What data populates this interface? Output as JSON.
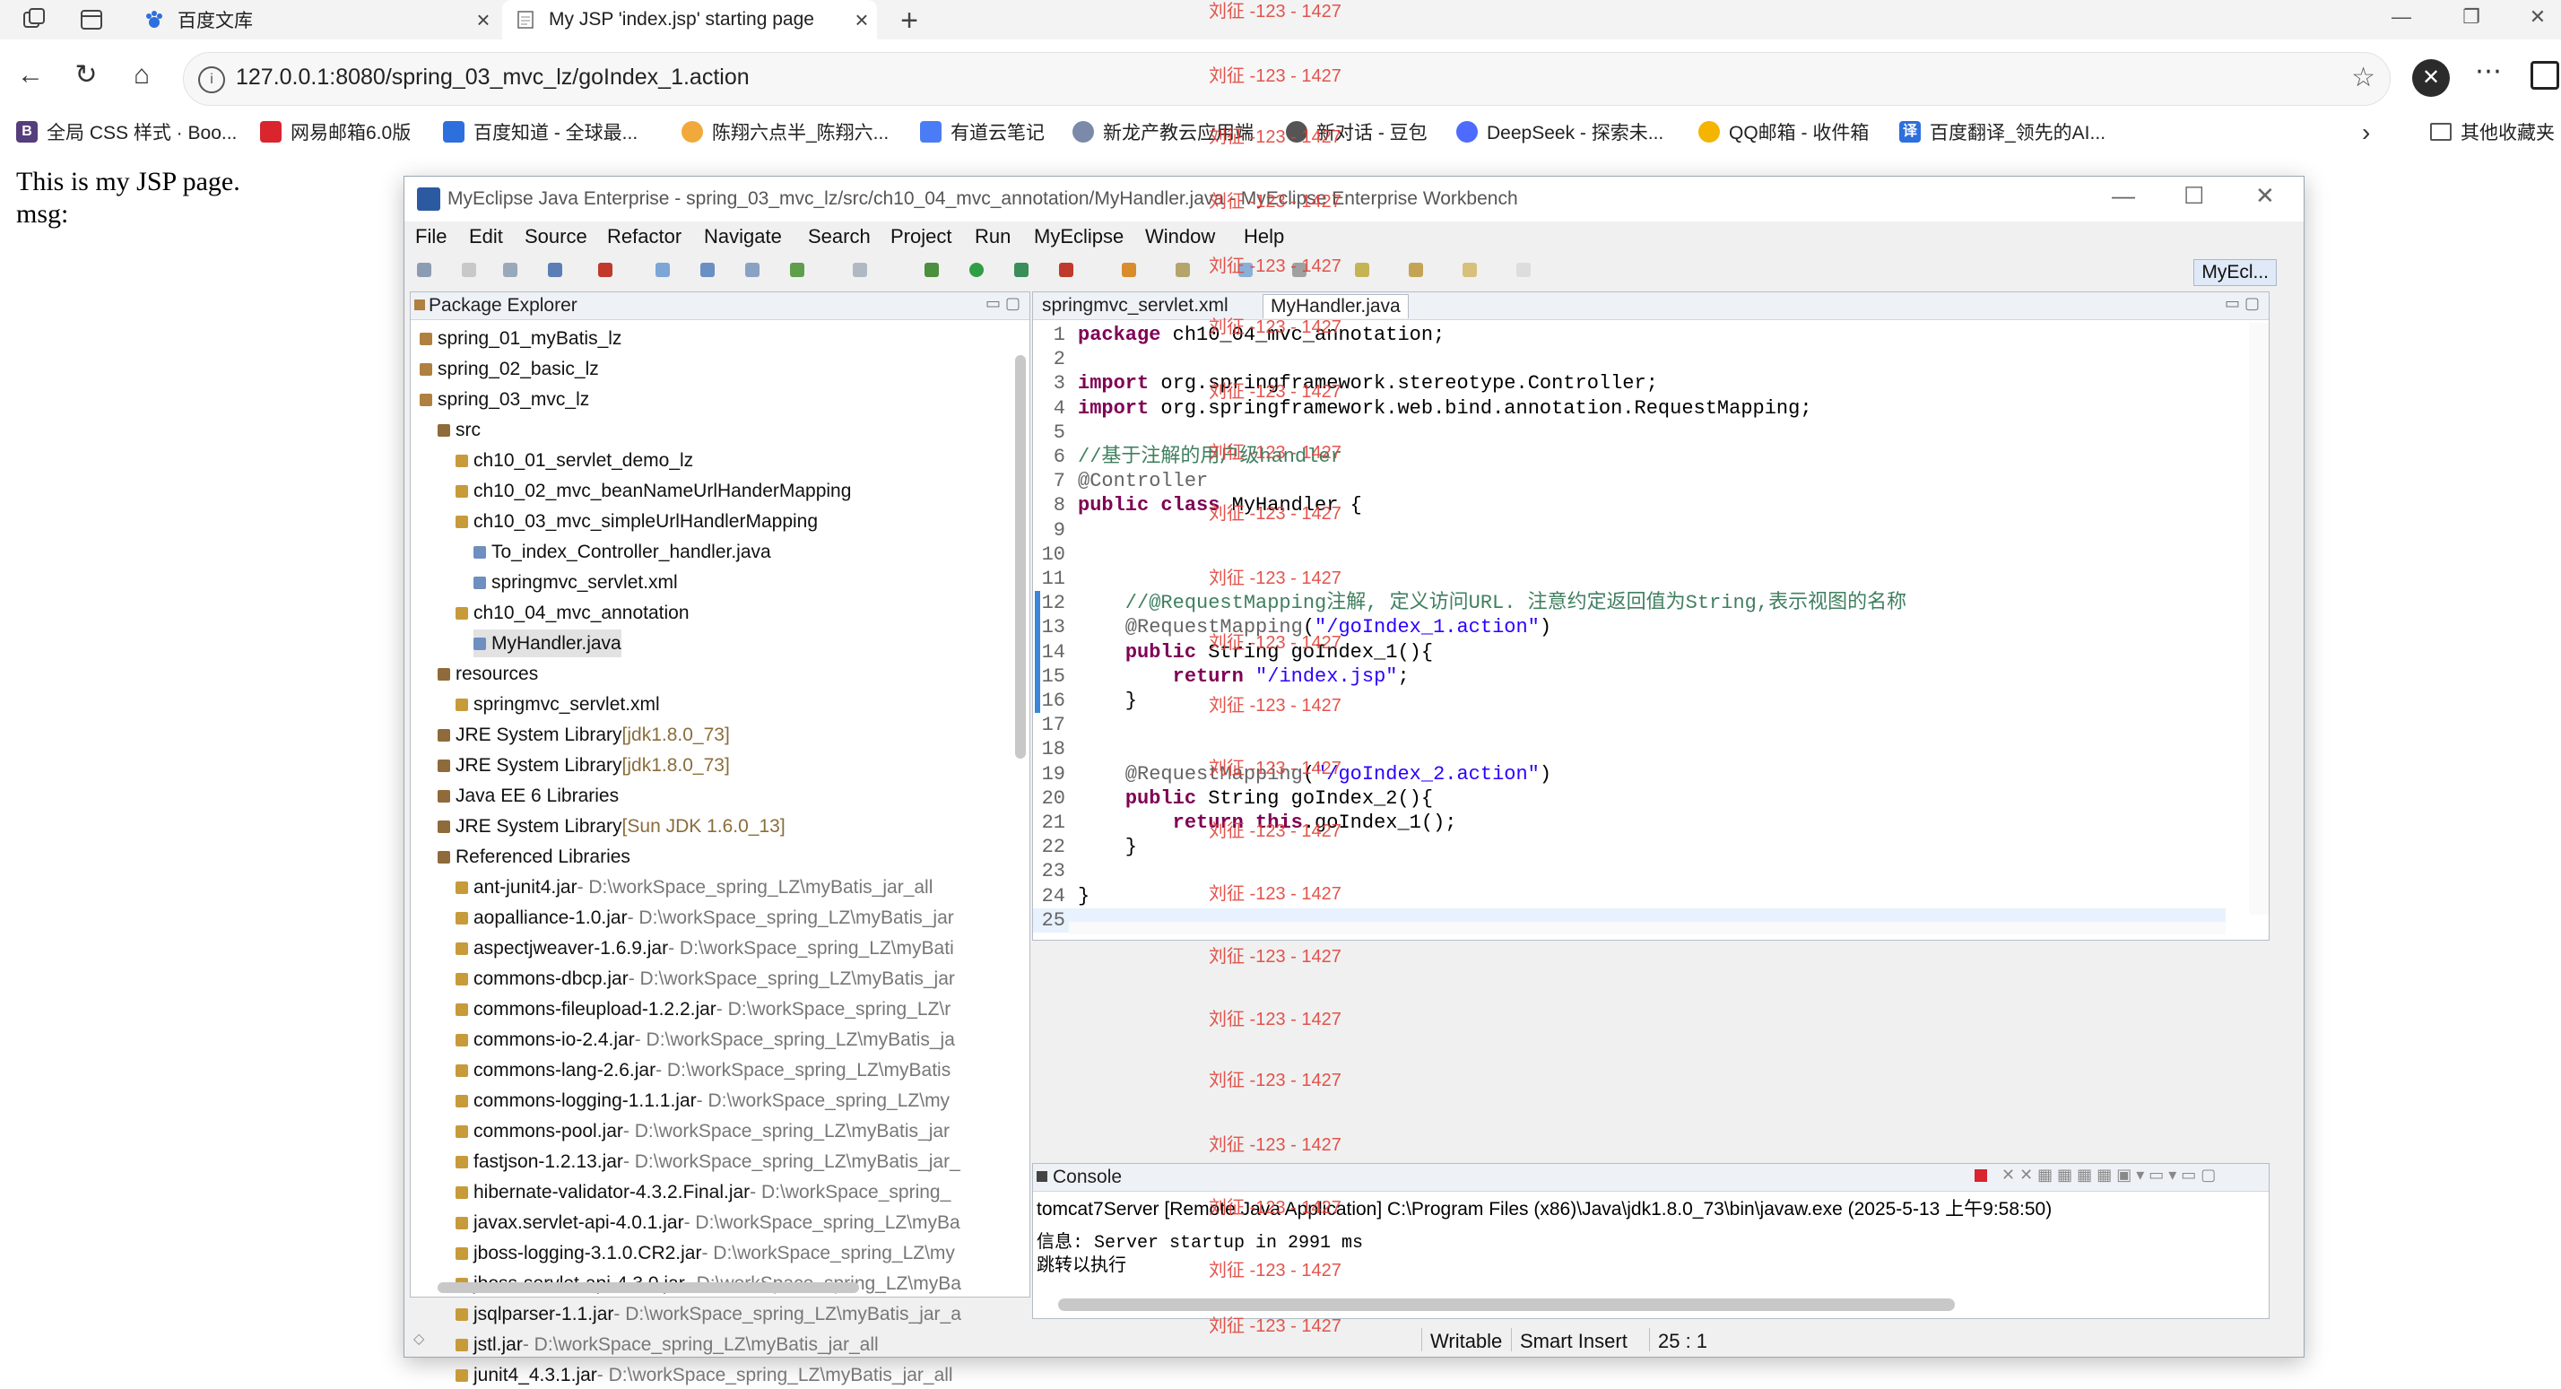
{
  "browser": {
    "tabs": [
      {
        "title": "百度文库",
        "active": false,
        "icon": "baidu-paw-icon"
      },
      {
        "title": "My JSP 'index.jsp' starting page",
        "active": true,
        "icon": "document-icon"
      }
    ],
    "address": "127.0.0.1:8080/spring_03_mvc_lz/goIndex_1.action",
    "bookmarks": [
      {
        "label": "全局 CSS 样式 · Boo...",
        "icon_letter": "B",
        "color": "#563d7c"
      },
      {
        "label": "网易邮箱6.0版",
        "icon_letter": "",
        "color": "#d9252e"
      },
      {
        "label": "百度知道 - 全球最...",
        "icon_letter": "",
        "color": "#2e6fde"
      },
      {
        "label": "陈翔六点半_陈翔六...",
        "icon_letter": "",
        "color": "#f2a93b"
      },
      {
        "label": "有道云笔记",
        "icon_letter": "",
        "color": "#4a7cf6"
      },
      {
        "label": "新龙产教云应用端",
        "icon_letter": "",
        "color": "#7a8aa8"
      },
      {
        "label": "新对话 - 豆包",
        "icon_letter": "",
        "color": "#555555"
      },
      {
        "label": "DeepSeek - 探索未...",
        "icon_letter": "",
        "color": "#4d6bfe"
      },
      {
        "label": "QQ邮箱 - 收件箱",
        "icon_letter": "",
        "color": "#f4b400"
      },
      {
        "label": "百度翻译_领先的AI...",
        "icon_letter": "译",
        "color": "#2e6fde"
      }
    ],
    "other_bookmarks": "其他收藏夹"
  },
  "page": {
    "line1": "This is my JSP page.",
    "line2": "msg:"
  },
  "ide": {
    "title": "MyEclipse Java Enterprise - spring_03_mvc_lz/src/ch10_04_mvc_annotation/MyHandler.java - MyEclipse Enterprise Workbench",
    "menu": [
      "File",
      "Edit",
      "Source",
      "Refactor",
      "Navigate",
      "Search",
      "Project",
      "Run",
      "MyEclipse",
      "Window",
      "Help"
    ],
    "perspective": "MyEcl...",
    "package_explorer": {
      "title": "Package Explorer",
      "tree": [
        {
          "label": "spring_01_myBatis_lz",
          "depth": 0
        },
        {
          "label": "spring_02_basic_lz",
          "depth": 0
        },
        {
          "label": "spring_03_mvc_lz",
          "depth": 0
        },
        {
          "label": "src",
          "depth": 1
        },
        {
          "label": "ch10_01_servlet_demo_lz",
          "depth": 2
        },
        {
          "label": "ch10_02_mvc_beanNameUrlHanderMapping",
          "depth": 2
        },
        {
          "label": "ch10_03_mvc_simpleUrlHandlerMapping",
          "depth": 2
        },
        {
          "label": "To_index_Controller_handler.java",
          "depth": 3
        },
        {
          "label": "springmvc_servlet.xml",
          "depth": 3
        },
        {
          "label": "ch10_04_mvc_annotation",
          "depth": 2
        },
        {
          "label": "MyHandler.java",
          "depth": 3,
          "selected": true
        },
        {
          "label": "resources",
          "depth": 1
        },
        {
          "label": "springmvc_servlet.xml",
          "depth": 2
        },
        {
          "label": "JRE System Library",
          "decoration": "[jdk1.8.0_73]",
          "depth": 1
        },
        {
          "label": "JRE System Library",
          "decoration": "[jdk1.8.0_73]",
          "depth": 1
        },
        {
          "label": "Java EE 6 Libraries",
          "depth": 1
        },
        {
          "label": "JRE System Library",
          "decoration": "[Sun JDK 1.6.0_13]",
          "depth": 1
        },
        {
          "label": "Referenced Libraries",
          "depth": 1
        },
        {
          "label": "ant-junit4.jar",
          "path": " - D:\\workSpace_spring_LZ\\myBatis_jar_all",
          "depth": 2
        },
        {
          "label": "aopalliance-1.0.jar",
          "path": " - D:\\workSpace_spring_LZ\\myBatis_jar",
          "depth": 2
        },
        {
          "label": "aspectjweaver-1.6.9.jar",
          "path": " - D:\\workSpace_spring_LZ\\myBati",
          "depth": 2
        },
        {
          "label": "commons-dbcp.jar",
          "path": " - D:\\workSpace_spring_LZ\\myBatis_jar",
          "depth": 2
        },
        {
          "label": "commons-fileupload-1.2.2.jar",
          "path": " - D:\\workSpace_spring_LZ\\r",
          "depth": 2
        },
        {
          "label": "commons-io-2.4.jar",
          "path": " - D:\\workSpace_spring_LZ\\myBatis_ja",
          "depth": 2
        },
        {
          "label": "commons-lang-2.6.jar",
          "path": " - D:\\workSpace_spring_LZ\\myBatis",
          "depth": 2
        },
        {
          "label": "commons-logging-1.1.1.jar",
          "path": " - D:\\workSpace_spring_LZ\\my",
          "depth": 2
        },
        {
          "label": "commons-pool.jar",
          "path": " - D:\\workSpace_spring_LZ\\myBatis_jar",
          "depth": 2
        },
        {
          "label": "fastjson-1.2.13.jar",
          "path": " - D:\\workSpace_spring_LZ\\myBatis_jar_",
          "depth": 2
        },
        {
          "label": "hibernate-validator-4.3.2.Final.jar",
          "path": " - D:\\workSpace_spring_",
          "depth": 2
        },
        {
          "label": "javax.servlet-api-4.0.1.jar",
          "path": " - D:\\workSpace_spring_LZ\\myBa",
          "depth": 2
        },
        {
          "label": "jboss-logging-3.1.0.CR2.jar",
          "path": " - D:\\workSpace_spring_LZ\\my",
          "depth": 2
        },
        {
          "label": "jboss-servlet-api-4.3.0.jar",
          "path": " - D:\\workSpace_spring_LZ\\myBa",
          "depth": 2
        },
        {
          "label": "jsqlparser-1.1.jar",
          "path": " - D:\\workSpace_spring_LZ\\myBatis_jar_a",
          "depth": 2
        },
        {
          "label": "jstl.jar",
          "path": " - D:\\workSpace_spring_LZ\\myBatis_jar_all",
          "depth": 2
        },
        {
          "label": "junit4_4.3.1.jar",
          "path": " - D:\\workSpace_spring_LZ\\myBatis_jar_all",
          "depth": 2
        }
      ]
    },
    "editor": {
      "tabs": [
        "springmvc_servlet.xml",
        "MyHandler.java"
      ],
      "lines": [
        [
          {
            "t": "package",
            "c": "kw"
          },
          {
            "t": " ch10_04_mvc_annotation;"
          }
        ],
        [],
        [
          {
            "t": "import",
            "c": "kw"
          },
          {
            "t": " org.springframework.stereotype.Controller;"
          }
        ],
        [
          {
            "t": "import",
            "c": "kw"
          },
          {
            "t": " org.springframework.web.bind.annotation.RequestMapping;"
          }
        ],
        [],
        [
          {
            "t": "//基于注解的用户级handler",
            "c": "cm"
          }
        ],
        [
          {
            "t": "@Controller",
            "c": "an"
          }
        ],
        [
          {
            "t": "public",
            "c": "kw"
          },
          {
            "t": " "
          },
          {
            "t": "class",
            "c": "kw"
          },
          {
            "t": " MyHandler {"
          }
        ],
        [],
        [],
        [],
        [
          {
            "t": "    //@RequestMapping注解, 定义访问URL. 注意约定返回值为String,表示视图的名称",
            "c": "cm"
          }
        ],
        [
          {
            "t": "    @RequestMapping",
            "c": "an"
          },
          {
            "t": "("
          },
          {
            "t": "\"/goIndex_1.action\"",
            "c": "st"
          },
          {
            "t": ")"
          }
        ],
        [
          {
            "t": "    "
          },
          {
            "t": "public",
            "c": "kw"
          },
          {
            "t": " String goIndex_1(){"
          }
        ],
        [
          {
            "t": "        "
          },
          {
            "t": "return",
            "c": "kw"
          },
          {
            "t": " "
          },
          {
            "t": "\"/index.jsp\"",
            "c": "st"
          },
          {
            "t": ";"
          }
        ],
        [
          {
            "t": "    }"
          }
        ],
        [],
        [],
        [
          {
            "t": "    @RequestMapping",
            "c": "an"
          },
          {
            "t": "("
          },
          {
            "t": "\"/goIndex_2.action\"",
            "c": "st"
          },
          {
            "t": ")"
          }
        ],
        [
          {
            "t": "    "
          },
          {
            "t": "public",
            "c": "kw"
          },
          {
            "t": " String goIndex_2(){"
          }
        ],
        [
          {
            "t": "        "
          },
          {
            "t": "return",
            "c": "kw"
          },
          {
            "t": " "
          },
          {
            "t": "this",
            "c": "kw"
          },
          {
            "t": ".goIndex_1();"
          }
        ],
        [
          {
            "t": "    }"
          }
        ],
        [],
        [
          {
            "t": "}"
          }
        ],
        []
      ],
      "current_line": 25
    },
    "console": {
      "title": "Console",
      "launch": "tomcat7Server [Remote Java Application] C:\\Program Files (x86)\\Java\\jdk1.8.0_73\\bin\\javaw.exe (2025-5-13 上午9:58:50)",
      "lines": [
        "信息: Server startup in 2991 ms",
        "跳转以执行"
      ]
    },
    "status": {
      "writable": "Writable",
      "insert": "Smart Insert",
      "position": "25 : 1"
    }
  },
  "watermark": "刘征 -123 - 1427"
}
